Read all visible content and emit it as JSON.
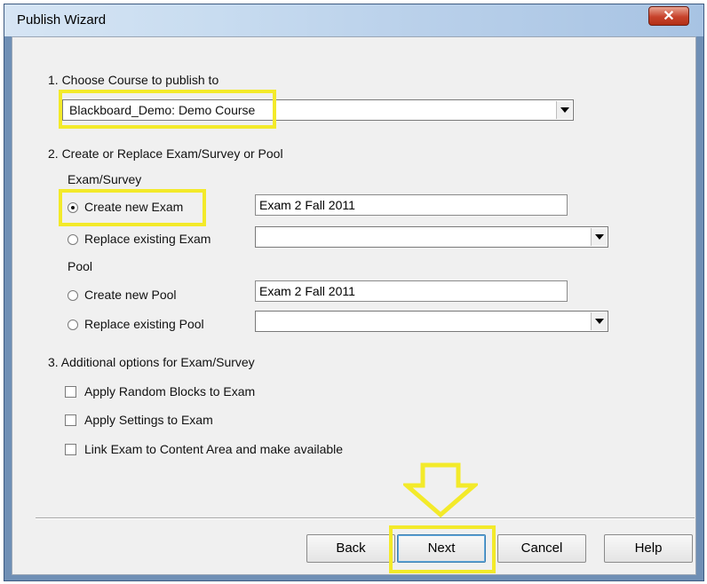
{
  "window": {
    "title": "Publish Wizard",
    "close_glyph": "✕"
  },
  "section1": {
    "heading": "1.  Choose Course to publish to",
    "course_selected": "Blackboard_Demo: Demo Course"
  },
  "section2": {
    "heading": "2.  Create or Replace Exam/Survey or Pool",
    "exam_group_label": "Exam/Survey",
    "create_exam_label": "Create new Exam",
    "create_exam_value": "Exam 2 Fall 2011",
    "replace_exam_label": "Replace existing Exam",
    "replace_exam_selected": "",
    "pool_group_label": "Pool",
    "create_pool_label": "Create new Pool",
    "create_pool_value": "Exam 2 Fall 2011",
    "replace_pool_label": "Replace existing Pool",
    "replace_pool_selected": ""
  },
  "section3": {
    "heading": "3.  Additional options for Exam/Survey",
    "options": [
      "Apply Random Blocks to Exam",
      "Apply Settings to Exam",
      "Link Exam to Content Area and make available"
    ]
  },
  "buttons": {
    "back": "Back",
    "next": "Next",
    "cancel": "Cancel",
    "help": "Help"
  },
  "highlight_color": "#f3ea2a"
}
